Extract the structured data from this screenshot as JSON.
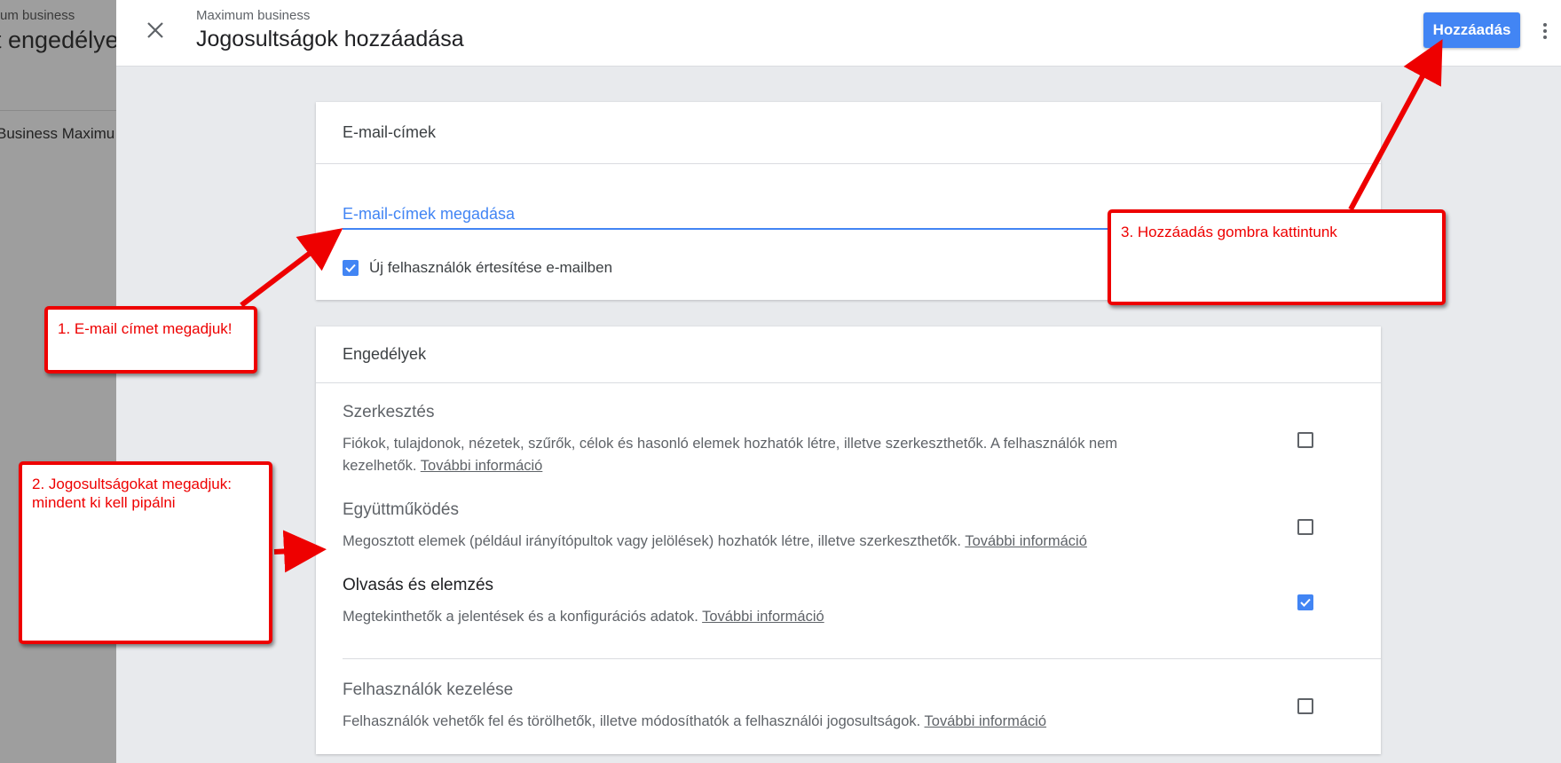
{
  "background": {
    "subtitle": "um business",
    "title": "t engedélye",
    "item": "Business Maximu"
  },
  "header": {
    "subtitle": "Maximum business",
    "title": "Jogosultságok hozzáadása",
    "add_button": "Hozzáadás",
    "close_icon": "close-icon",
    "more_icon": "more-vert-icon"
  },
  "email_card": {
    "heading": "E-mail-címek",
    "input_placeholder": "E-mail-címek megadása",
    "input_value": "",
    "notify_label": "Új felhasználók értesítése e-mailben",
    "notify_checked": true
  },
  "permissions_card": {
    "heading": "Engedélyek",
    "more_info": "További információ",
    "items": [
      {
        "title": "Szerkesztés",
        "description": "Fiókok, tulajdonok, nézetek, szűrők, célok és hasonló elemek hozhatók létre, illetve szerkeszthetők. A felhasználók nem kezelhetők.",
        "checked": false
      },
      {
        "title": "Együttműködés",
        "description": "Megosztott elemek (például irányítópultok vagy jelölések) hozhatók létre, illetve szerkeszthetők.",
        "checked": false
      },
      {
        "title": "Olvasás és elemzés",
        "description": "Megtekinthetők a jelentések és a konfigurációs adatok.",
        "checked": true
      },
      {
        "title": "Felhasználók kezelése",
        "description": "Felhasználók vehetők fel és törölhetők, illetve módosíthatók a felhasználói jogosultságok.",
        "checked": false
      }
    ]
  },
  "annotations": {
    "step1": "1. E-mail címet megadjuk!",
    "step2": "2. Jogosultságokat megadjuk: mindent ki kell pipálni",
    "step3": "3. Hozzáadás gombra kattintunk"
  },
  "colors": {
    "accent": "#4285f4",
    "annotation": "#ee0000"
  }
}
